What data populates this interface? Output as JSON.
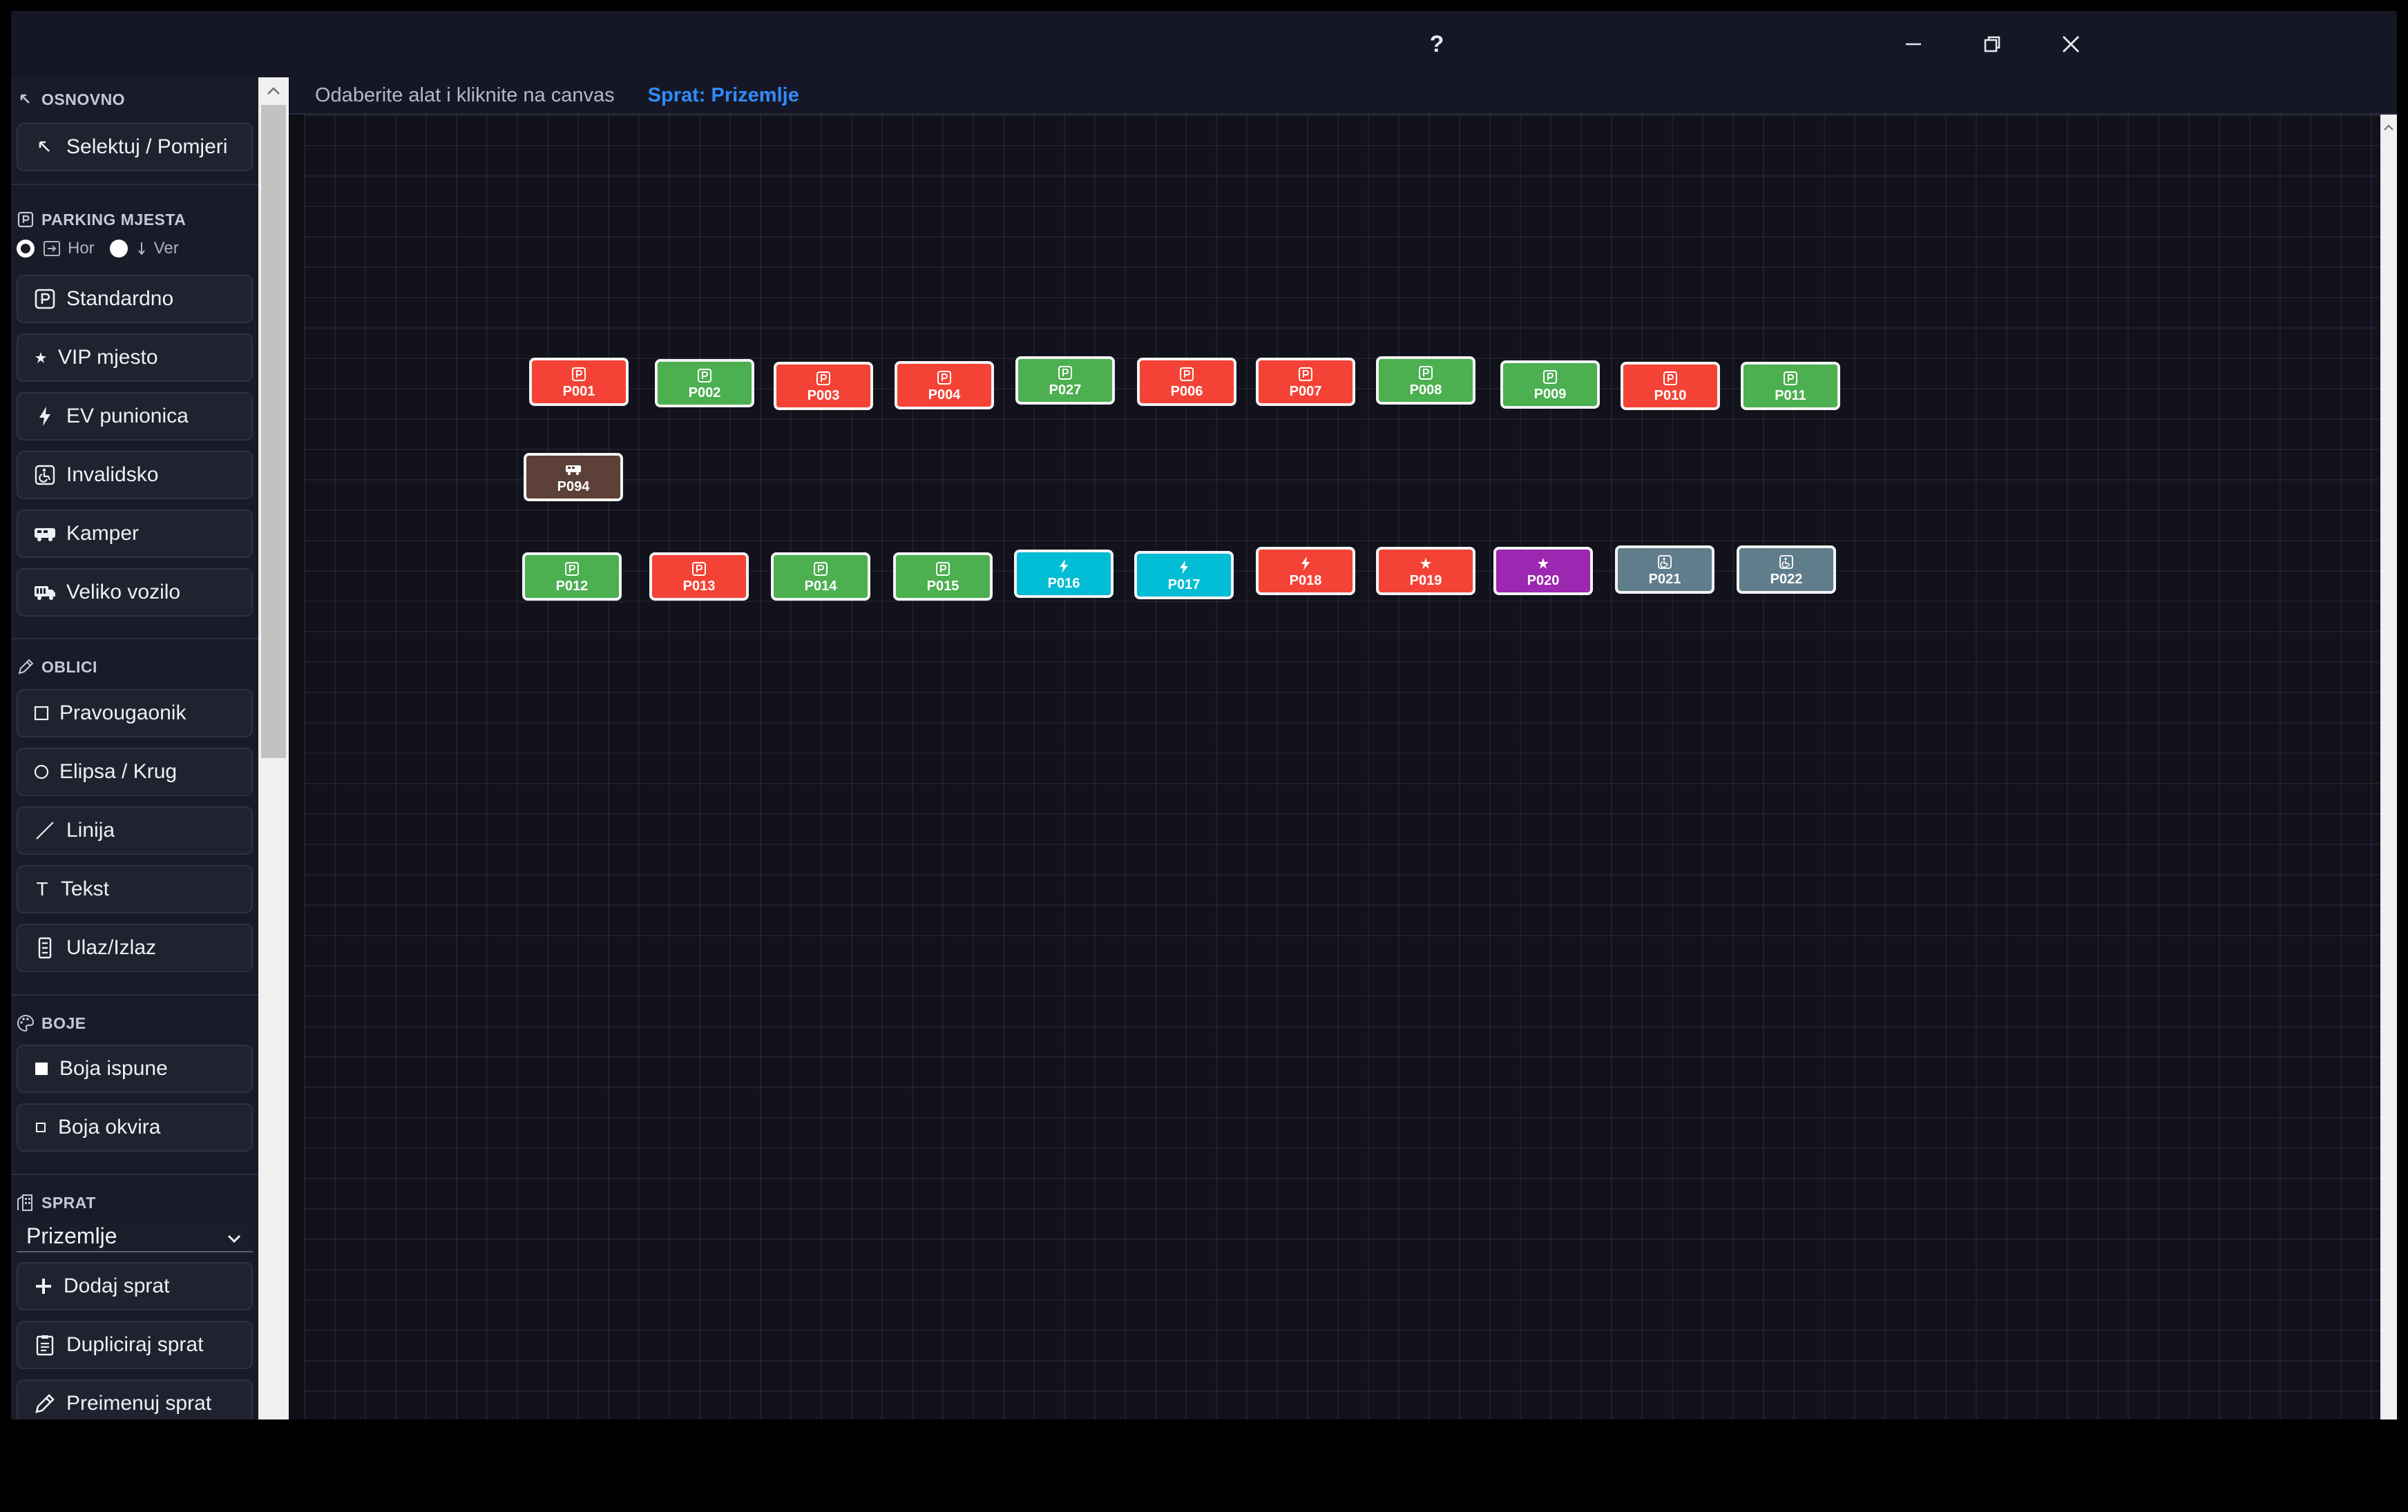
{
  "window": {
    "help_label": "?",
    "controls": [
      "minimize-icon",
      "restore-icon",
      "close-icon"
    ]
  },
  "sidebar": {
    "basic": {
      "title": "OSNOVNO",
      "select_tool": "Selektuj / Pomjeri"
    },
    "parking": {
      "title": "PARKING MJESTA",
      "orientation": {
        "horizontal_label": "Hor",
        "vertical_label": "Ver",
        "selected": "Hor"
      },
      "tools": [
        {
          "label": "Standardno",
          "icon": "parking-icon"
        },
        {
          "label": "VIP mjesto",
          "icon": "star-icon"
        },
        {
          "label": "EV punionica",
          "icon": "bolt-icon"
        },
        {
          "label": "Invalidsko",
          "icon": "wheelchair-icon"
        },
        {
          "label": "Kamper",
          "icon": "camper-icon"
        },
        {
          "label": "Veliko vozilo",
          "icon": "truck-icon"
        }
      ]
    },
    "shapes": {
      "title": "OBLICI",
      "tools": [
        {
          "label": "Pravougaonik",
          "icon": "rectangle-icon"
        },
        {
          "label": "Elipsa / Krug",
          "icon": "ellipse-icon"
        },
        {
          "label": "Linija",
          "icon": "line-icon"
        },
        {
          "label": "Tekst",
          "icon": "text-icon"
        },
        {
          "label": "Ulaz/Izlaz",
          "icon": "entrance-icon"
        }
      ]
    },
    "colors": {
      "title": "BOJE",
      "fill_label": "Boja ispune",
      "border_label": "Boja okvira"
    },
    "floor": {
      "title": "SPRAT",
      "selected": "Prizemlje",
      "add_label": "Dodaj sprat",
      "duplicate_label": "Dupliciraj sprat",
      "rename_label": "Preimenuj sprat"
    }
  },
  "infobar": {
    "hint": "Odaberite alat i kliknite na canvas",
    "floor_label": "Sprat: Prizemlje"
  },
  "spot_types": {
    "standard": {
      "color": "#4caf50",
      "icon": "parking-icon"
    },
    "standard_occupied": {
      "color": "#f44336",
      "icon": "parking-icon"
    },
    "ev": {
      "color": "#00bcd4",
      "icon": "bolt-icon"
    },
    "ev_occupied": {
      "color": "#f44336",
      "icon": "bolt-icon"
    },
    "vip": {
      "color": "#9c27b0",
      "icon": "star-icon"
    },
    "vip_occupied": {
      "color": "#f44336",
      "icon": "star-icon"
    },
    "disabled": {
      "color": "#607d8b",
      "icon": "wheelchair-icon"
    },
    "camper": {
      "color": "#5d4037",
      "icon": "camper-icon"
    }
  },
  "spots": [
    {
      "id": "P001",
      "type": "standard_occupied"
    },
    {
      "id": "P002",
      "type": "standard"
    },
    {
      "id": "P003",
      "type": "standard_occupied"
    },
    {
      "id": "P004",
      "type": "standard_occupied"
    },
    {
      "id": "P027",
      "type": "standard"
    },
    {
      "id": "P006",
      "type": "standard_occupied"
    },
    {
      "id": "P007",
      "type": "standard_occupied"
    },
    {
      "id": "P008",
      "type": "standard"
    },
    {
      "id": "P009",
      "type": "standard"
    },
    {
      "id": "P010",
      "type": "standard_occupied"
    },
    {
      "id": "P011",
      "type": "standard"
    },
    {
      "id": "P094",
      "type": "camper"
    },
    {
      "id": "P012",
      "type": "standard"
    },
    {
      "id": "P013",
      "type": "standard_occupied"
    },
    {
      "id": "P014",
      "type": "standard"
    },
    {
      "id": "P015",
      "type": "standard"
    },
    {
      "id": "P016",
      "type": "ev"
    },
    {
      "id": "P017",
      "type": "ev"
    },
    {
      "id": "P018",
      "type": "ev_occupied"
    },
    {
      "id": "P019",
      "type": "vip_occupied"
    },
    {
      "id": "P020",
      "type": "vip"
    },
    {
      "id": "P021",
      "type": "disabled"
    },
    {
      "id": "P022",
      "type": "disabled"
    }
  ]
}
